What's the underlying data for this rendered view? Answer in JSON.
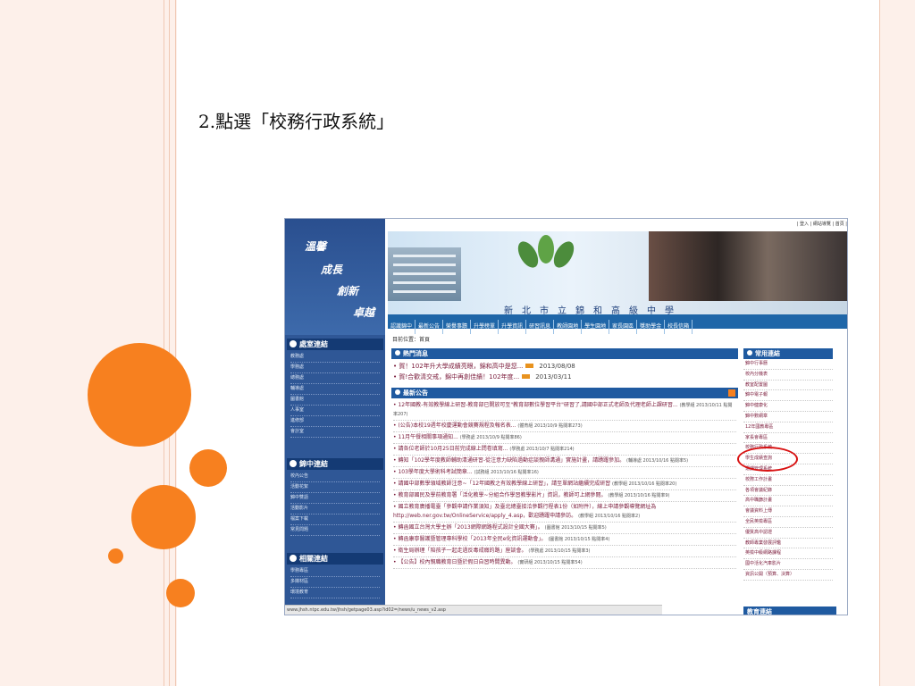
{
  "slide": {
    "title": "2.點選「校務行政系統」"
  },
  "screenshot": {
    "slogan": [
      "溫馨",
      "成長",
      "創新",
      "卓越"
    ],
    "topbar": "| 登入 | 網站導覽 | 首頁 |",
    "school_name": "新北市立錦和高級中學",
    "nav": [
      "認識錦中",
      "最新公告",
      "榮譽事蹟",
      "升學榜單",
      "升學資訊",
      "研習訊息",
      "教師園地",
      "學生園地",
      "家長園區",
      "獎助學金",
      "校長信箱"
    ],
    "breadcrumb": "目前位置：首頁",
    "left_sections": [
      {
        "title": "處室連結",
        "items": [
          "教務處",
          "學務處",
          "總務處",
          "輔導處",
          "圖書館",
          "人事室",
          "進修部",
          "會計室"
        ]
      },
      {
        "title": "錦中連結",
        "items": [
          "校內公告",
          "活動花絮",
          "錦中雙語",
          "活動影片",
          "檔案下載",
          "常見問題"
        ]
      },
      {
        "title": "相關連結",
        "items": [
          "學務專區",
          "多媒材區",
          "環境教育"
        ]
      }
    ],
    "hot_title": "熱門消息",
    "hot_items": [
      {
        "text": "賀！102年升大學成績亮眼，錦和高中是您...",
        "date": "2013/08/08"
      },
      {
        "text": "賀!合歡清交戒，錦中再創佳績！102年度...",
        "date": "2013/03/11"
      }
    ],
    "news_title": "最新公告",
    "news_items": [
      {
        "text": "12年國教-有效教學線上研習-教育部已開放可至\"教育部數位學習平台\"研習了,請國中部正式老師及代理老師上課研習...",
        "meta": "(教學組 2013/10/11 點閱率207)"
      },
      {
        "text": "(公告)本校19週年校慶運動會競賽規程及報名表...",
        "meta": "(體育組 2013/10/9 點閱率273)"
      },
      {
        "text": "11月午餐相關事項通知...",
        "meta": "(學務處 2013/10/9 點閱率86)"
      },
      {
        "text": "請各位老師於10月25日前完成線上問卷填寫...",
        "meta": "(學務處 2013/10/7 點閱率214)"
      },
      {
        "text": "轉知「102學年度教師輔助清通研習-從注意力缺陷過動症談親師溝通」實施計畫，請踴躍參加。",
        "meta": "(輔導處 2013/10/16 點閱率5)"
      },
      {
        "text": "103學年度大學術科考試簡章...",
        "meta": "(試務組 2013/10/16 點閱率16)"
      },
      {
        "text": "請國中部數學領域教師注意~「12年國教之有效教學線上研習」，請至單網站繼續完成研習",
        "meta": "(教學組 2013/10/16 點閱率20)"
      },
      {
        "text": "教育部國民及學前教育署「活化教學~分組合作學習教學影片」資訊，教師可上網參閱。",
        "meta": "(教學組 2013/10/16 點閱率9)"
      },
      {
        "text": "國立教育廣播電臺「參觀申請作業須知」及臺北總臺接洽參觀行程表1份（如附件），線上申請參觀導覽網址為http://web.ner.gov.tw/OnlineService/apply_4.asp，歡迎踴躍申請參訪。",
        "meta": "(教學組 2013/10/16 點閱率2)"
      },
      {
        "text": "轉函國立台灣大學主辦「2013網際網路程式設計全國大賽」。",
        "meta": "(圖書館 2013/10/15 點閱率5)"
      },
      {
        "text": "轉函康寧醫護暨管理專科學校「2013年全民e化資訊運動會」。",
        "meta": "(圖書館 2013/10/15 點閱率4)"
      },
      {
        "text": "衛生局辦理「陪孩子一起走過反毒戒癮的路」座談會。",
        "meta": "(學務處 2013/10/15 點閱率3)"
      },
      {
        "text": "【公告】校內親職教育日暨於假日自習時間異動。",
        "meta": "(實研組 2013/10/15 點閱率54)"
      }
    ],
    "common_title": "常用連結",
    "common_links": [
      "錦中行事曆",
      "校內分機表",
      "教室配置圖",
      "錦中電子報",
      "錦中健康化",
      "錦中數網章",
      "12年國教專區",
      "家長會專區",
      "校務行政系統",
      "學生成績查詢",
      "選課管理系統",
      "校際工作計畫",
      "各項會議紀錄",
      "高中職篩計畫",
      "會議資料上傳",
      "全民英檢專區",
      "優質高中認證",
      "教師專業發展評鑑",
      "英檢中級網路課程",
      "國中活化汽車影片",
      "資訊公開（預算、決算）"
    ],
    "edu_title": "教育連結",
    "status_url": "www.jhsh.ntpc.edu.tw/jhsh/getpage03.asp?id02=/news/u_news_v2.asp"
  },
  "colors": {
    "accent_orange": "#f7801f",
    "site_blue": "#1f5aa0",
    "highlight_red": "#d81212"
  }
}
